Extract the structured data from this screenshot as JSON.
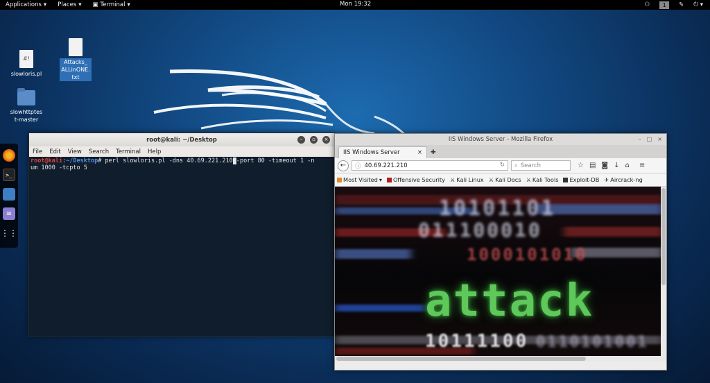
{
  "topbar": {
    "applications": "Applications",
    "places": "Places",
    "terminal": "Terminal",
    "clock": "Mon 19:32",
    "workspace": "1"
  },
  "desktop": {
    "icons": [
      {
        "glyph": "#!",
        "label": "slowloris.pl"
      },
      {
        "glyph": "",
        "label": "Attacks_ ALLinONE. txt"
      },
      {
        "glyph": "",
        "label": "slowhttptes t-master"
      }
    ]
  },
  "terminal": {
    "title": "root@kali: ~/Desktop",
    "menu": [
      "File",
      "Edit",
      "View",
      "Search",
      "Terminal",
      "Help"
    ],
    "prompt_user": "root@kali",
    "prompt_path": ":~/Desktop",
    "prompt_hash": "# ",
    "command_before": "perl slowloris.pl -dns 40.69.221.210",
    "command_after": "-port 80 -timeout 1 -n",
    "line2": "um 1000 -tcpto 5"
  },
  "firefox": {
    "window_title": "IIS Windows Server - Mozilla Firefox",
    "tab_title": "IIS Windows Server",
    "url": "40.69.221.210",
    "search_placeholder": "Search",
    "bookmarks": [
      "Most Visited",
      "Offensive Security",
      "Kali Linux",
      "Kali Docs",
      "Kali Tools",
      "Exploit-DB",
      "Aircrack-ng"
    ],
    "page_word": "attack",
    "binary_rows": [
      "10101101",
      "011100010",
      "1000101010",
      "10111100",
      "0110101001"
    ]
  },
  "colors": {
    "prompt_user": "#e0433a",
    "prompt_path": "#4f8ee0",
    "attack_green": "#5ec85a",
    "terminal_bg": "#0f1d2c"
  }
}
